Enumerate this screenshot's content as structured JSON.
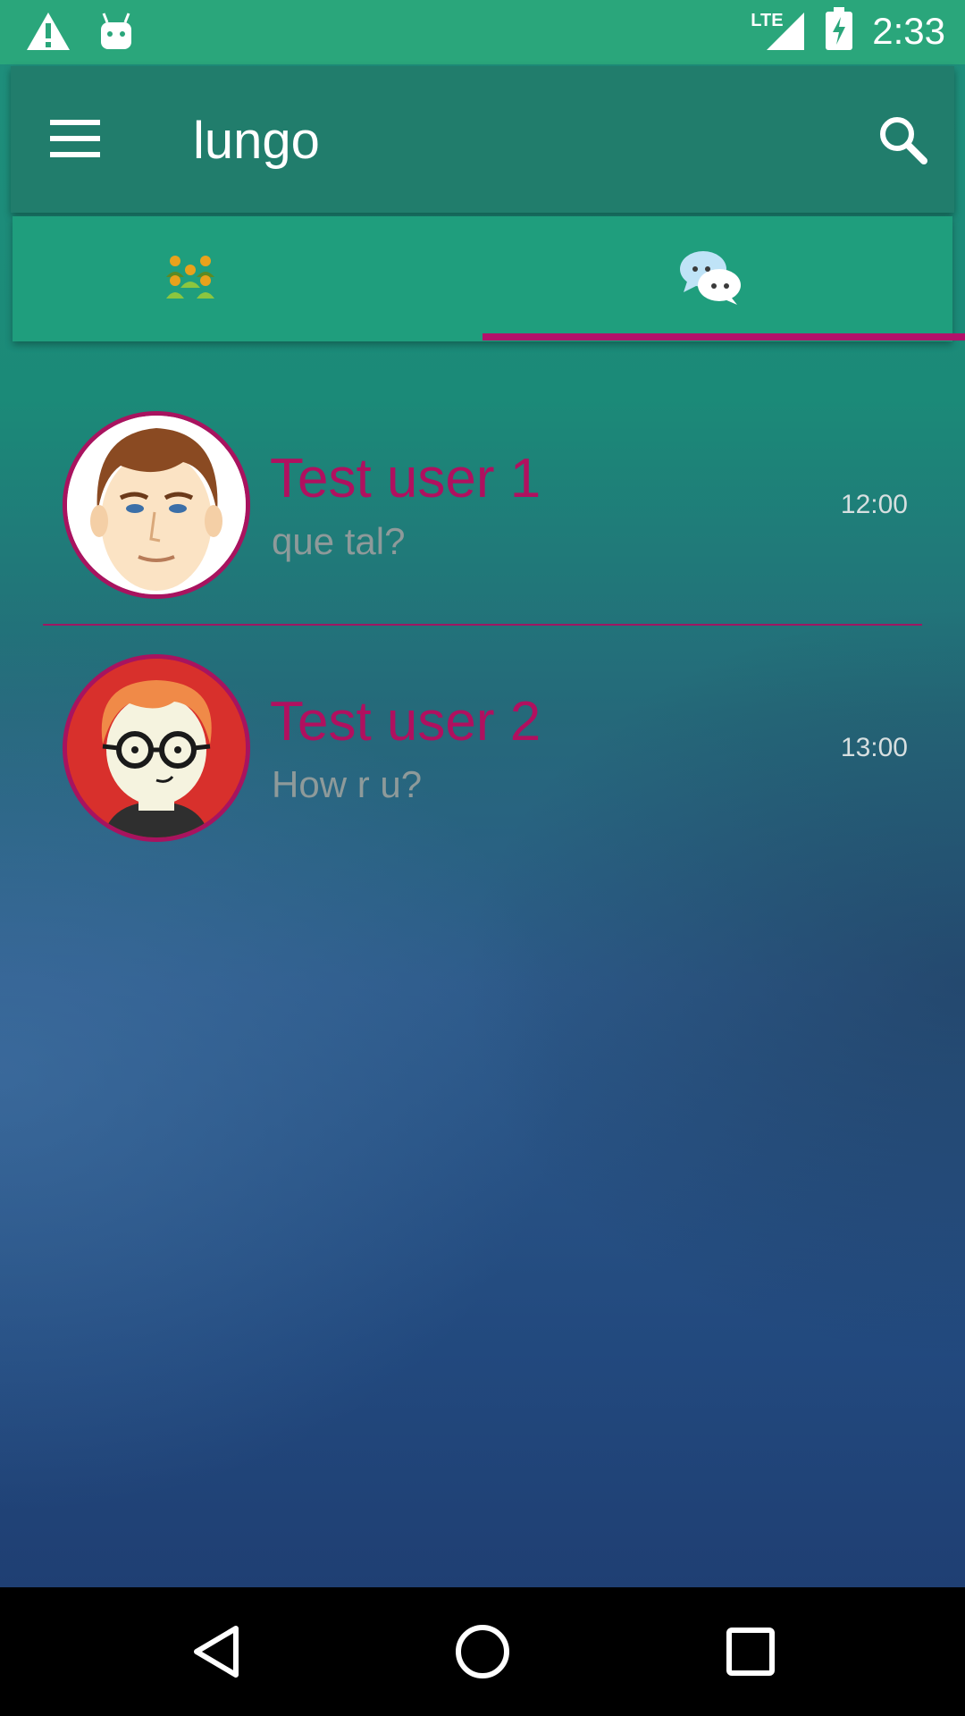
{
  "status_bar": {
    "time": "2:33",
    "network_label": "LTE",
    "icons": [
      "warning-icon",
      "android-icon",
      "signal-icon",
      "battery-charging-icon"
    ]
  },
  "app_bar": {
    "title": "lungo",
    "menu_icon": "menu-icon",
    "search_icon": "search-icon"
  },
  "tabs": [
    {
      "name": "contacts",
      "icon": "contacts-icon",
      "selected": false
    },
    {
      "name": "chats",
      "icon": "chat-bubbles-icon",
      "selected": true
    }
  ],
  "chats": [
    {
      "name": "Test user 1",
      "message": "que tal?",
      "time": "12:00",
      "avatar": "man-avatar"
    },
    {
      "name": "Test user 2",
      "message": "How r u?",
      "time": "13:00",
      "avatar": "glasses-avatar"
    }
  ],
  "colors": {
    "accent": "#b0105f",
    "app_bar": "#217d6c",
    "tab_bar": "#1f9e7d",
    "status_bar": "#2aa67b"
  },
  "nav_bar": {
    "buttons": [
      "back-icon",
      "home-icon",
      "recents-icon"
    ]
  }
}
